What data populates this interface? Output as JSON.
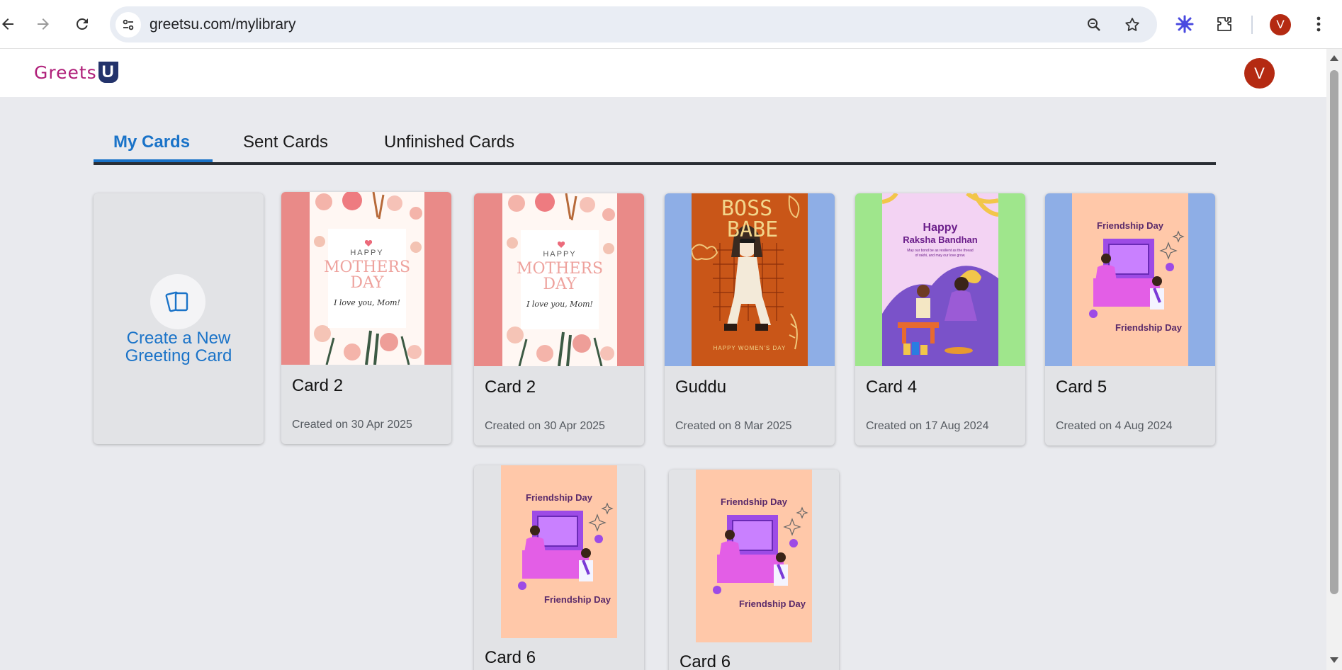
{
  "browser": {
    "url": "greetsu.com/mylibrary",
    "profile_initial": "V"
  },
  "app": {
    "logo_text": "Greets",
    "logo_u": "U",
    "avatar_initial": "V"
  },
  "tabs": [
    {
      "label": "My Cards",
      "active": true
    },
    {
      "label": "Sent Cards",
      "active": false
    },
    {
      "label": "Unfinished Cards",
      "active": false
    }
  ],
  "create_card": {
    "label_line1": "Create a New",
    "label_line2": "Greeting Card"
  },
  "cards": [
    {
      "title": "Card 2",
      "date": "Created on 30 Apr 2025",
      "design": "mothers-day"
    },
    {
      "title": "Card 2",
      "date": "Created on 30 Apr 2025",
      "design": "mothers-day"
    },
    {
      "title": "Guddu",
      "date": "Created on 8 Mar 2025",
      "design": "boss-babe"
    },
    {
      "title": "Card 4",
      "date": "Created on 17 Aug 2024",
      "design": "raksha-bandhan"
    },
    {
      "title": "Card 5",
      "date": "Created on 4 Aug 2024",
      "design": "friendship-day"
    },
    {
      "title": "Card 6",
      "date": "",
      "design": "friendship-day"
    },
    {
      "title": "Card 6",
      "date": "",
      "design": "friendship-day"
    }
  ],
  "card_art": {
    "mothers_day": {
      "line1": "HAPPY",
      "line2": "MOTHERS",
      "line3": "DAY",
      "line4": "I love you, Mom!"
    },
    "boss_babe": {
      "line1": "BOSS",
      "line2": "BABE",
      "line3": "HAPPY WOMEN'S DAY"
    },
    "raksha": {
      "line1": "Happy",
      "line2": "Raksha Bandhan",
      "line3": "May our bond be as resilient as the thread",
      "line4": "of rakhi, and may our love grow."
    },
    "friendship": {
      "top": "Friendship Day",
      "bottom": "Friendship Day"
    }
  },
  "colors": {
    "accent": "#1a73c8",
    "avatar": "#b42a12",
    "logo_pink": "#b0207a",
    "logo_navy": "#23336b"
  }
}
